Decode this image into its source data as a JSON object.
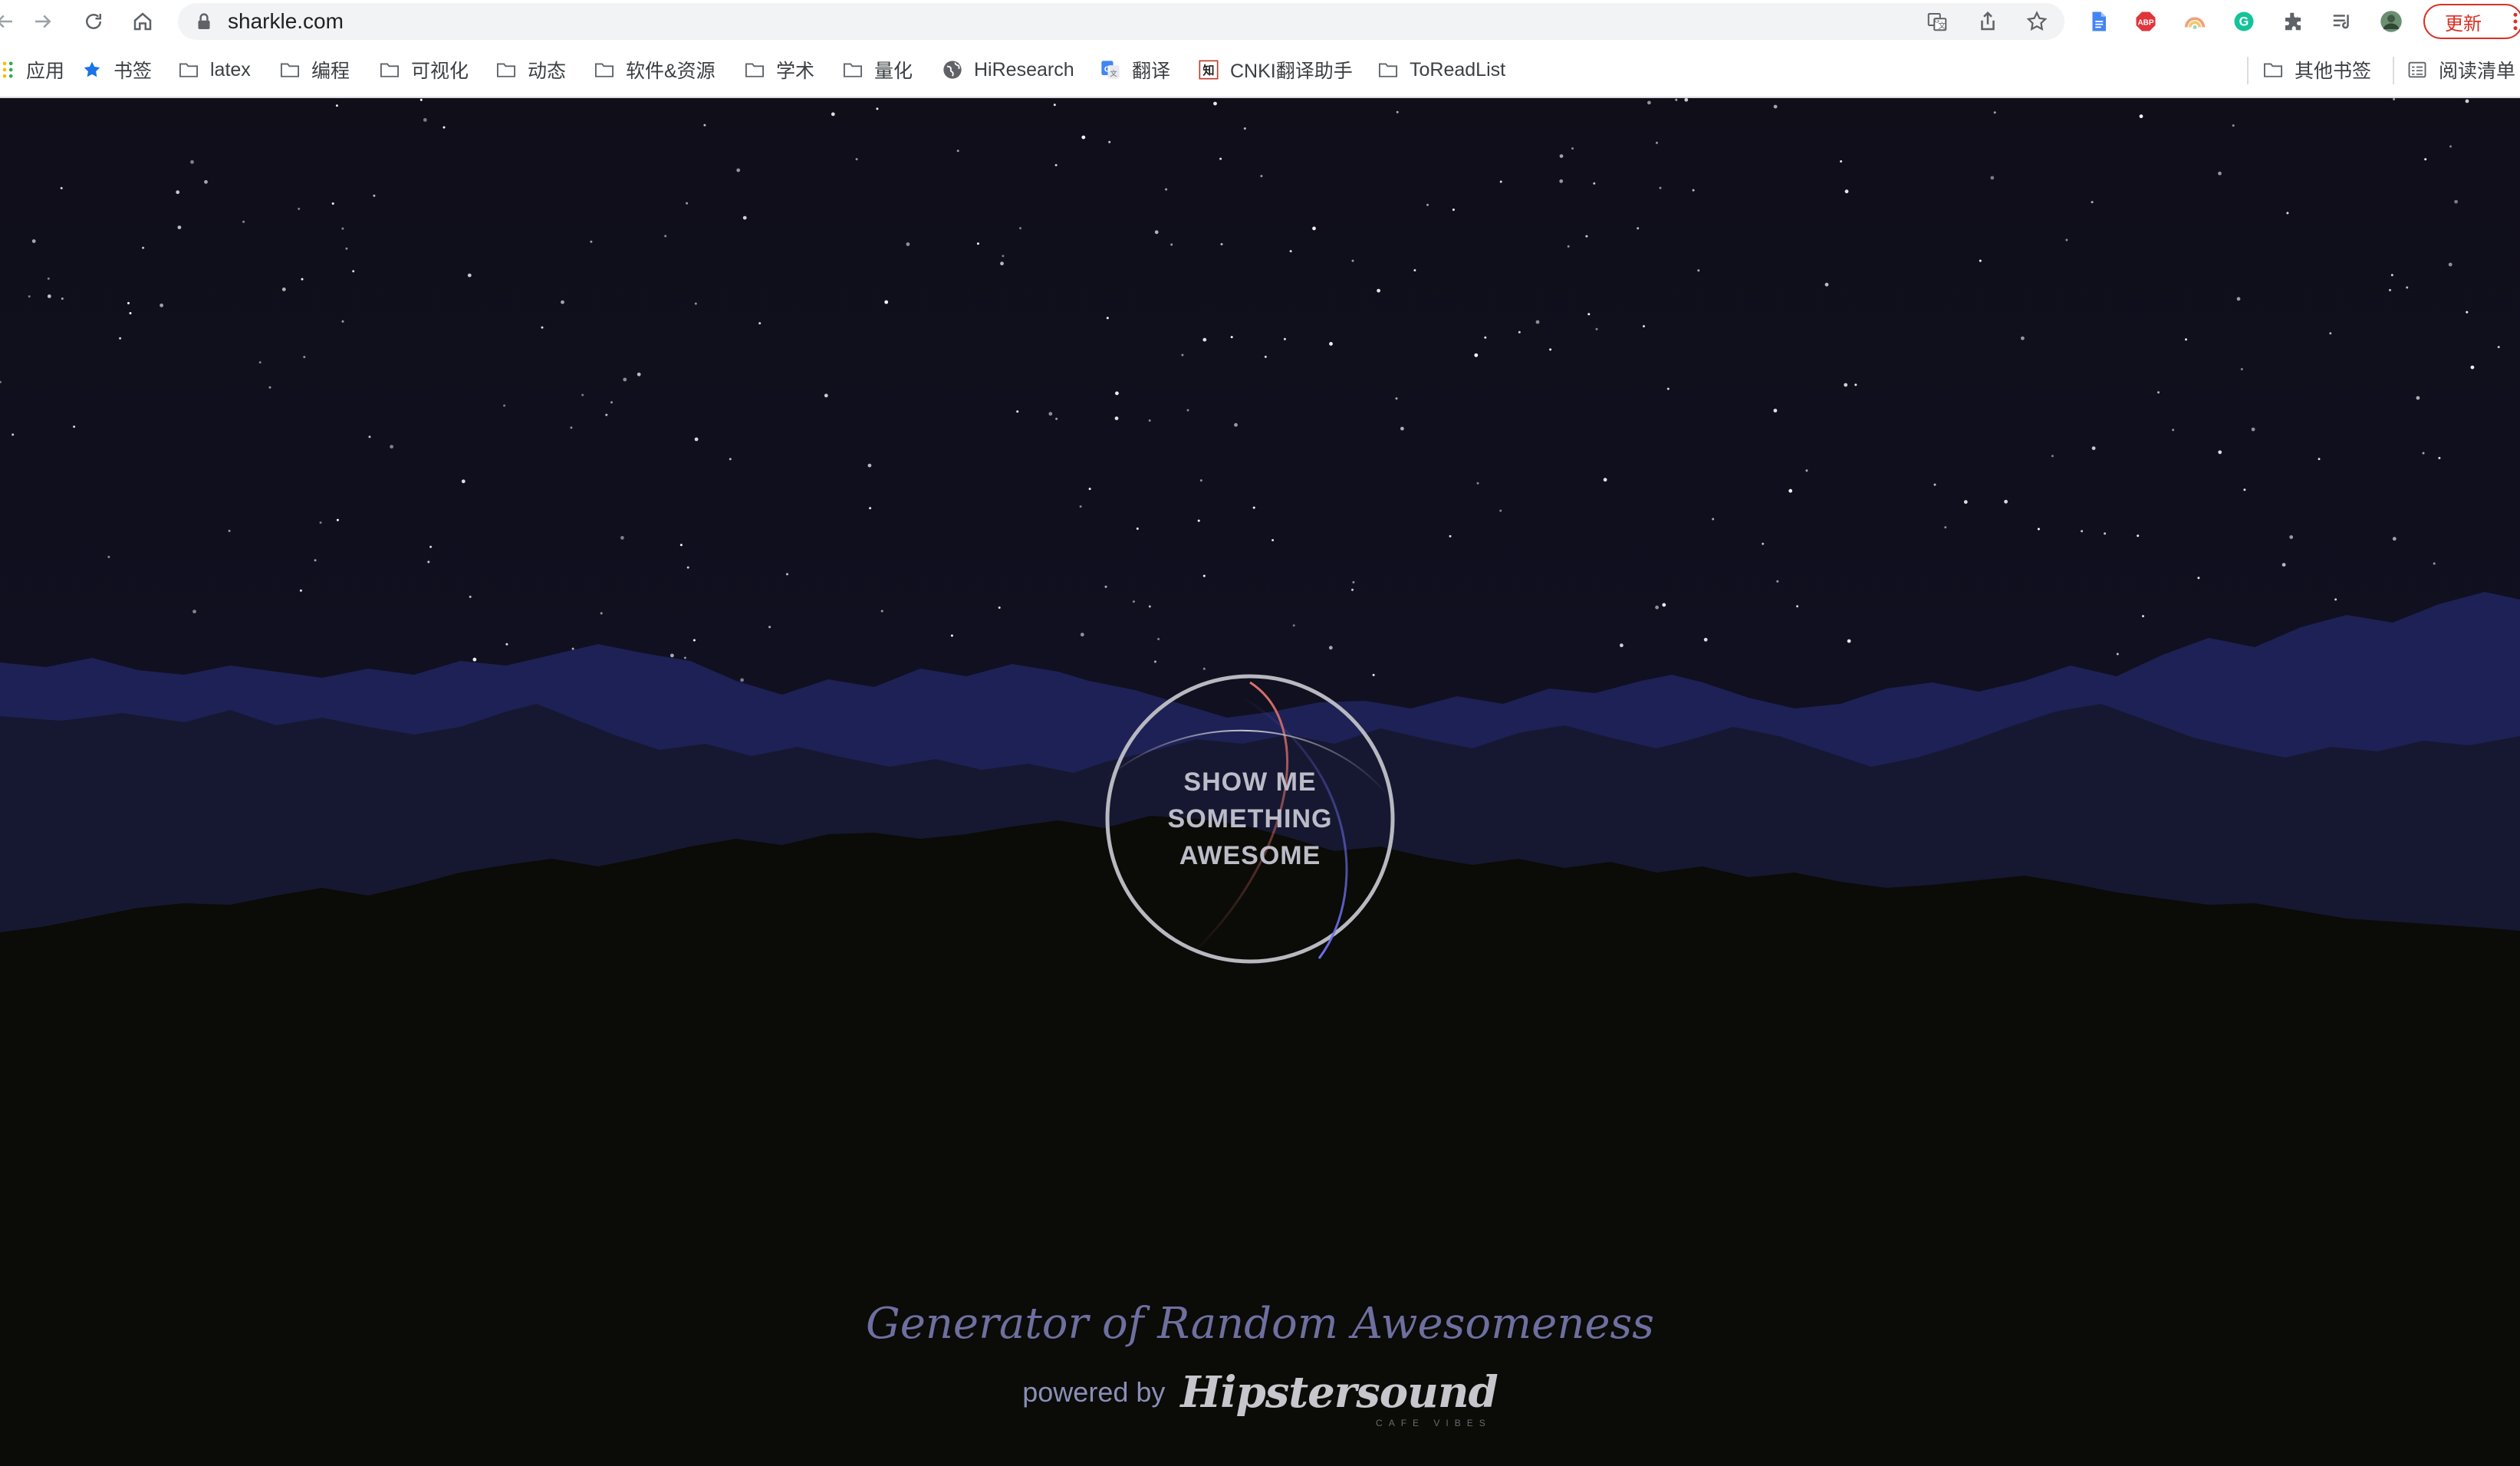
{
  "browser": {
    "url": "sharkle.com",
    "update_label": "更新",
    "bookmarks": [
      {
        "label": "应用",
        "icon": "apps-grid-icon"
      },
      {
        "label": "书签",
        "icon": "star-icon"
      },
      {
        "label": "latex",
        "icon": "folder-icon"
      },
      {
        "label": "编程",
        "icon": "folder-icon"
      },
      {
        "label": "可视化",
        "icon": "folder-icon"
      },
      {
        "label": "动态",
        "icon": "folder-icon"
      },
      {
        "label": "软件&资源",
        "icon": "folder-icon"
      },
      {
        "label": "学术",
        "icon": "folder-icon"
      },
      {
        "label": "量化",
        "icon": "folder-icon"
      },
      {
        "label": "HiResearch",
        "icon": "globe-icon"
      },
      {
        "label": "翻译",
        "icon": "google-translate-icon"
      },
      {
        "label": "CNKI翻译助手",
        "icon": "cnki-icon"
      },
      {
        "label": "ToReadList",
        "icon": "folder-icon"
      }
    ],
    "other_bookmarks": {
      "label": "其他书签",
      "icon": "folder-icon"
    },
    "reading_list": {
      "label": "阅读清单",
      "icon": "reading-list-icon"
    }
  },
  "page": {
    "cta_lines": [
      "SHOW ME",
      "SOMETHING",
      "AWESOME"
    ],
    "tagline": "Generator of Random Awesomeness",
    "powered_by": "powered by",
    "brand": "Hipstersound",
    "brand_sub": "CAFE VIBES"
  },
  "colors": {
    "sky": "#0f0e1a",
    "far_mountains": "#1e2154",
    "mid_mountains": "#161833",
    "ground": "#0b0b07",
    "tagline": "#6e6fa0",
    "accent_red": "#d9776f",
    "accent_blue": "#6a6fe0"
  }
}
